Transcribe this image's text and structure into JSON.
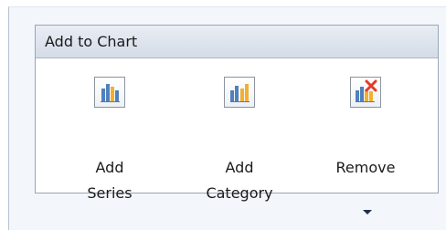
{
  "group": {
    "title": "Add to Chart",
    "commands": [
      {
        "line1": "Add",
        "line2": "Series",
        "icon": "add-series-chart-icon"
      },
      {
        "line1": "Add",
        "line2": "Category",
        "icon": "add-category-chart-icon"
      },
      {
        "line1": "Remove",
        "line2": "",
        "icon": "remove-chart-icon"
      }
    ]
  },
  "colors": {
    "header_top": "#e9edf4",
    "header_bottom": "#d5dce7",
    "border": "#9aa6b8",
    "pane": "#f3f6fb",
    "bar_blue": "#4f81bd",
    "bar_yellow": "#f2b02f",
    "cross_red": "#e33a2a"
  }
}
